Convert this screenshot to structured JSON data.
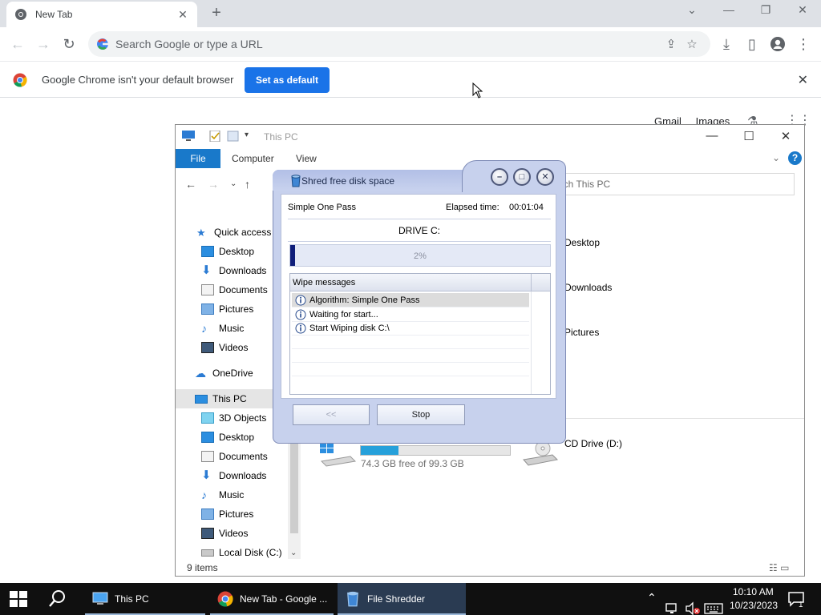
{
  "chrome": {
    "tab_title": "New Tab",
    "omnibox_placeholder": "Search Google or type a URL",
    "infobar_text": "Google Chrome isn't your default browser",
    "set_default_label": "Set as default",
    "google_links": [
      "Gmail",
      "Images"
    ]
  },
  "explorer": {
    "title": "This PC",
    "ribbon": {
      "file": "File",
      "tabs": [
        "Computer",
        "View"
      ],
      "help": "?"
    },
    "search_placeholder": "arch This PC",
    "nav": [
      {
        "label": "Quick access",
        "icon": "star-icon"
      },
      {
        "label": "Desktop",
        "icon": "desktop-folder-icon"
      },
      {
        "label": "Downloads",
        "icon": "download-arrow-icon"
      },
      {
        "label": "Documents",
        "icon": "documents-icon"
      },
      {
        "label": "Pictures",
        "icon": "pictures-icon"
      },
      {
        "label": "Music",
        "icon": "music-note-icon"
      },
      {
        "label": "Videos",
        "icon": "videos-icon"
      },
      {
        "label": "OneDrive",
        "icon": "cloud-icon"
      },
      {
        "label": "This PC",
        "icon": "computer-icon"
      },
      {
        "label": "3D Objects",
        "icon": "cube-icon"
      },
      {
        "label": "Desktop",
        "icon": "desktop-folder-icon"
      },
      {
        "label": "Documents",
        "icon": "documents-icon"
      },
      {
        "label": "Downloads",
        "icon": "download-arrow-icon"
      },
      {
        "label": "Music",
        "icon": "music-note-icon"
      },
      {
        "label": "Pictures",
        "icon": "pictures-icon"
      },
      {
        "label": "Videos",
        "icon": "videos-icon"
      },
      {
        "label": "Local Disk (C:)",
        "icon": "disk-icon"
      }
    ],
    "folders_visible": [
      "Desktop",
      "Downloads",
      "Pictures"
    ],
    "drive_free_text": "74.3 GB free of 99.3 GB",
    "drive_used_fraction": 0.25,
    "cd_drive": "CD Drive (D:)",
    "status": "9 items"
  },
  "shredder": {
    "title": "Shred free disk space",
    "method": "Simple One Pass",
    "elapsed_label": "Elapsed time:",
    "elapsed_value": "00:01:04",
    "drive_label": "DRIVE C:",
    "progress_percent": 2,
    "progress_text": "2%",
    "messages_header": "Wipe messages",
    "messages": [
      "Algorithm: Simple One Pass",
      "Waiting for start...",
      "Start Wiping disk C:\\"
    ],
    "back_label": "<<",
    "stop_label": "Stop"
  },
  "taskbar": {
    "items": [
      "This PC",
      "New Tab - Google ...",
      "File Shredder"
    ],
    "time": "10:10 AM",
    "date": "10/23/2023",
    "notification_count": "1"
  },
  "colors": {
    "accent": "#1a73e8",
    "explorer_file_tab": "#1979ca",
    "progress_fill": "#0f1e7a",
    "taskbar": "#101010"
  }
}
